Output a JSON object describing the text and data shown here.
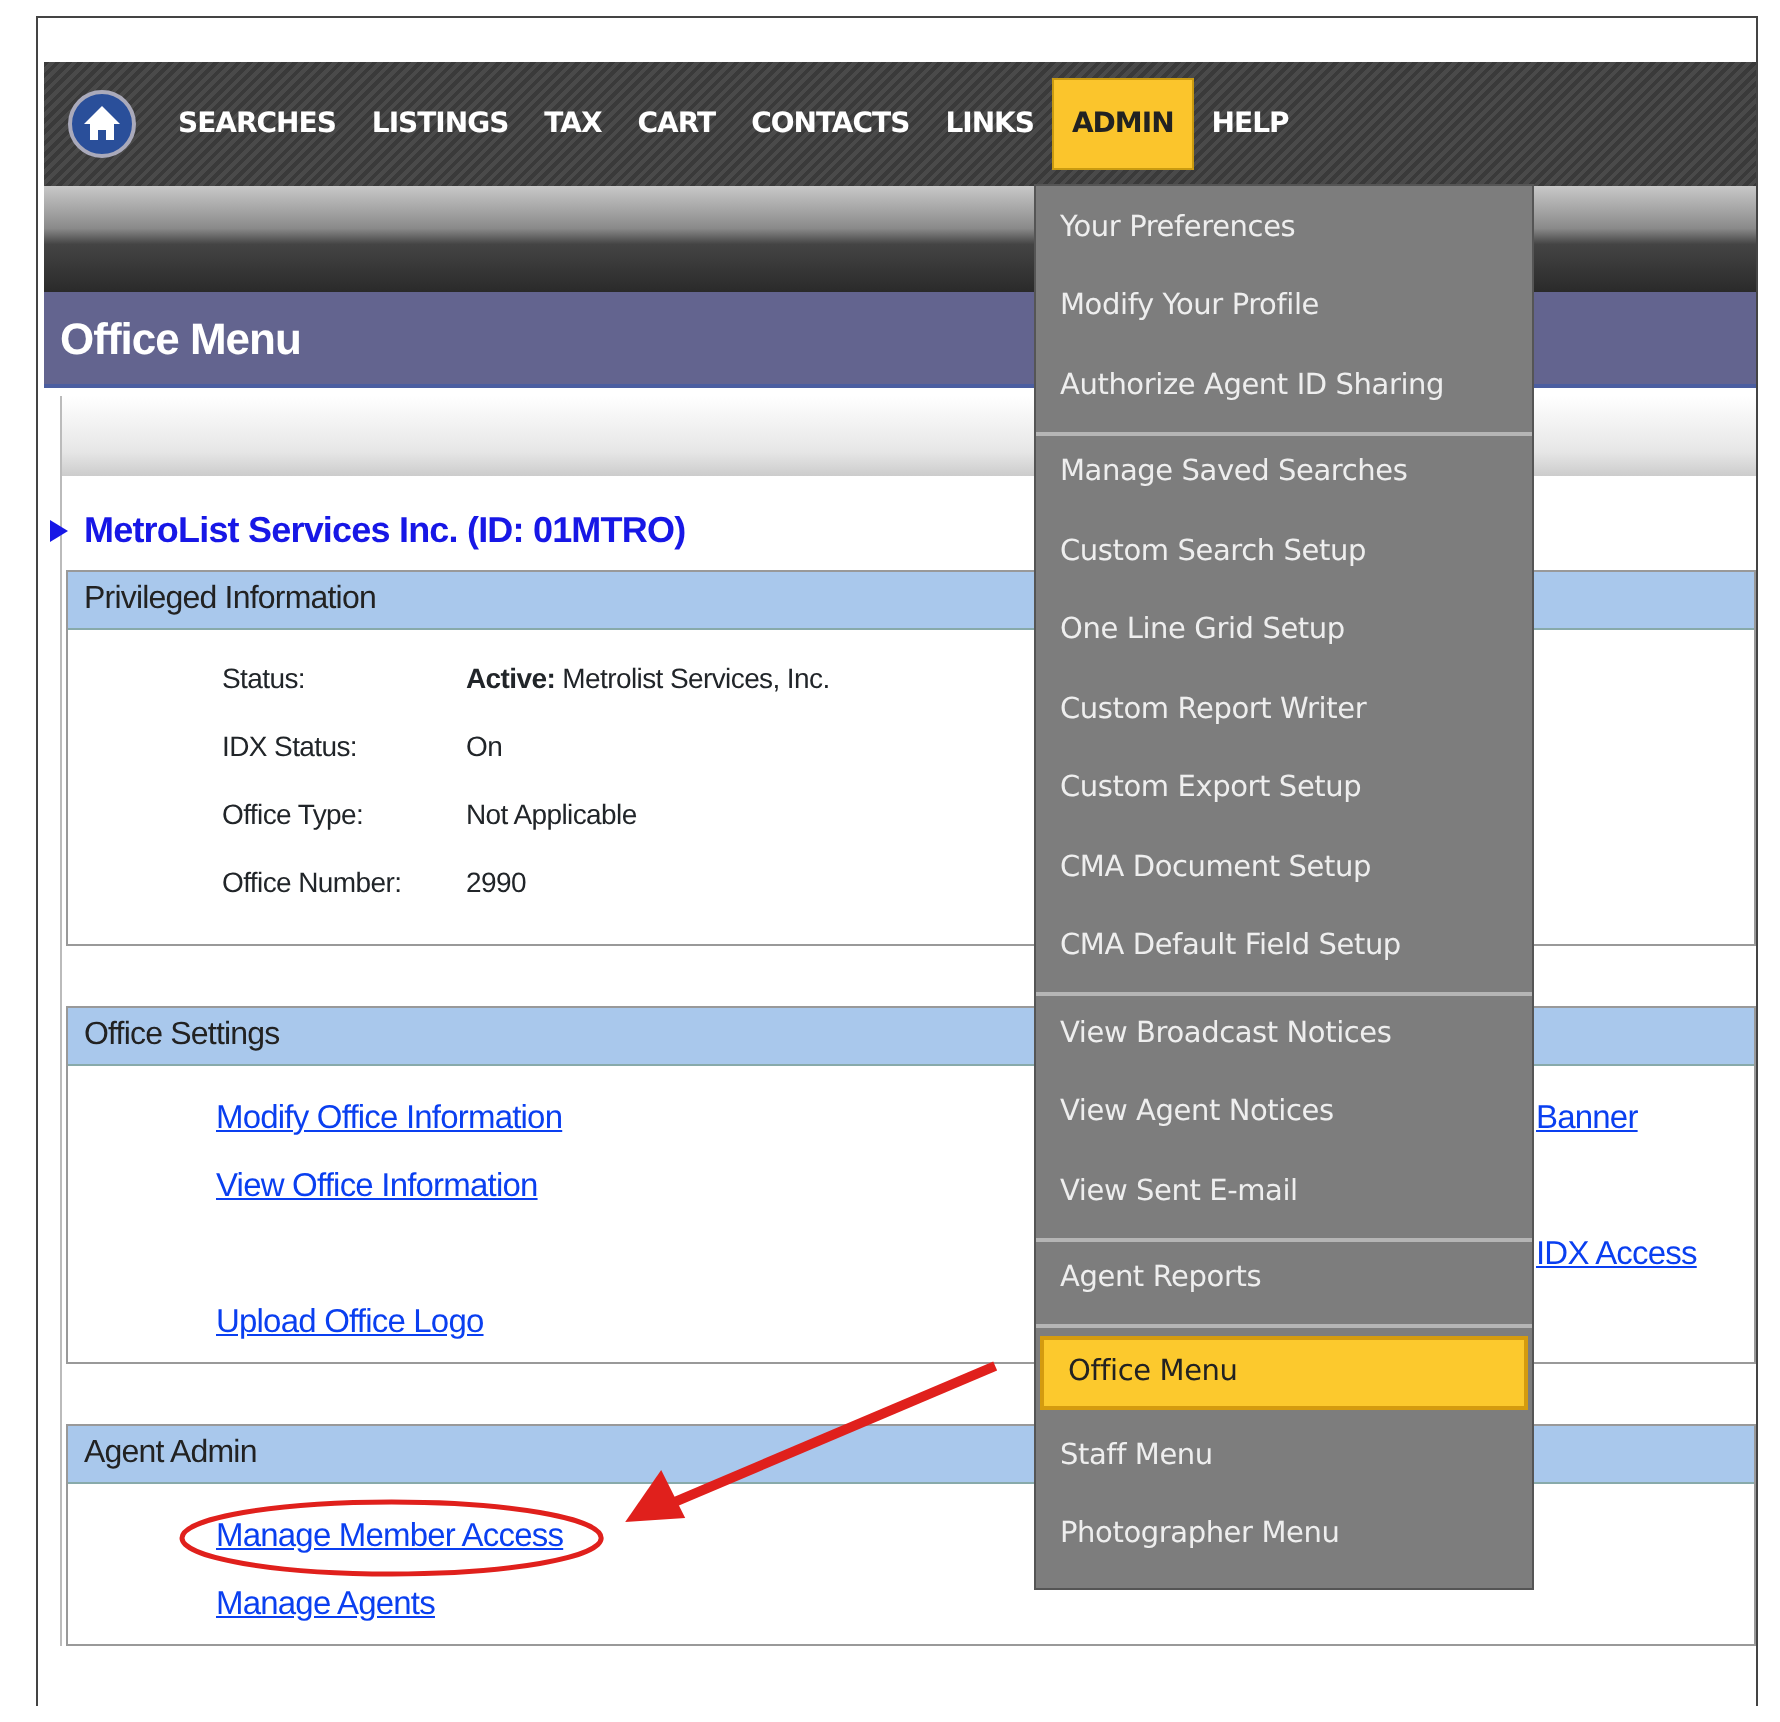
{
  "nav": {
    "items": [
      {
        "label": "SEARCHES",
        "selected": false
      },
      {
        "label": "LISTINGS",
        "selected": false
      },
      {
        "label": "TAX",
        "selected": false
      },
      {
        "label": "CART",
        "selected": false
      },
      {
        "label": "CONTACTS",
        "selected": false
      },
      {
        "label": "LINKS",
        "selected": false
      },
      {
        "label": "ADMIN",
        "selected": true
      },
      {
        "label": "HELP",
        "selected": false
      }
    ]
  },
  "admin_menu": {
    "groups": [
      {
        "items": [
          {
            "label": "Your Preferences",
            "selected": false
          },
          {
            "label": "Modify Your Profile",
            "selected": false
          },
          {
            "label": "Authorize Agent ID Sharing",
            "selected": false
          }
        ]
      },
      {
        "items": [
          {
            "label": "Manage Saved Searches",
            "selected": false
          },
          {
            "label": "Custom Search Setup",
            "selected": false
          },
          {
            "label": "One Line Grid Setup",
            "selected": false
          },
          {
            "label": "Custom Report Writer",
            "selected": false
          },
          {
            "label": "Custom Export Setup",
            "selected": false
          },
          {
            "label": "CMA Document Setup",
            "selected": false
          },
          {
            "label": "CMA Default Field Setup",
            "selected": false
          }
        ]
      },
      {
        "items": [
          {
            "label": "View Broadcast Notices",
            "selected": false
          },
          {
            "label": "View Agent Notices",
            "selected": false
          },
          {
            "label": "View Sent E-mail",
            "selected": false
          }
        ]
      },
      {
        "items": [
          {
            "label": "Agent Reports",
            "selected": false
          }
        ]
      },
      {
        "items": [
          {
            "label": "Office Menu",
            "selected": true
          },
          {
            "label": "Staff Menu",
            "selected": false
          },
          {
            "label": "Photographer Menu",
            "selected": false
          }
        ]
      }
    ]
  },
  "page_title": "Office Menu",
  "office": {
    "name": "MetroList Services Inc. (ID: 01MTRO)"
  },
  "sections": [
    {
      "title": "Privileged Information",
      "kind": "fields",
      "rows": [
        {
          "label": "Status:",
          "value": "**Active:** Metrolist Services, Inc."
        },
        {
          "label": "IDX Status:",
          "value": "On"
        },
        {
          "label": "Office Type:",
          "value": "Not Applicable"
        },
        {
          "label": "Office Number:",
          "value": "2990"
        }
      ]
    },
    {
      "title": "Office Settings",
      "kind": "links",
      "rows": [
        {
          "left": "Modify Office Information",
          "right": "Banner"
        },
        {
          "left": "View Office Information"
        },
        {
          "right": "IDX Access"
        },
        {
          "left": "Upload Office Logo"
        }
      ]
    },
    {
      "title": "Agent Admin",
      "kind": "links",
      "rows": [
        {
          "left": "Manage Member Access",
          "circled": true
        },
        {
          "left": "Manage Agents"
        }
      ]
    }
  ]
}
